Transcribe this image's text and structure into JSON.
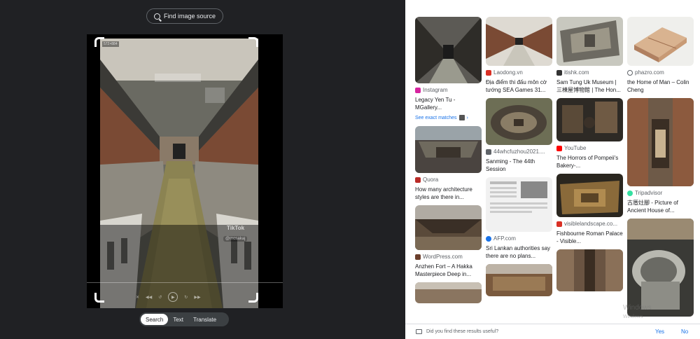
{
  "left": {
    "find_source_label": "Find image source",
    "size_badge": "572×884",
    "watermark_brand": "TikTok",
    "watermark_user": "@mosakaj",
    "modes": [
      "Search",
      "Text",
      "Translate"
    ],
    "active_mode": "Search"
  },
  "results": {
    "col1": [
      {
        "source": "Instagram",
        "title": "Legacy Yen Tu - MGallery...",
        "exact_matches": "See exact matches",
        "icon_color": "#d6249f"
      },
      {
        "source": "Quora",
        "title": "How many architecture styles are there in...",
        "icon_color": "#b92b27"
      },
      {
        "source": "WordPress.com",
        "title": "Anzhen Fort – A Hakka Masterpiece Deep in...",
        "icon_color": "#6b3f2c"
      }
    ],
    "col2": [
      {
        "source": "Laodong.vn",
        "title": "Địa điểm thi đấu môn cờ tướng SEA Games 31...",
        "icon_color": "#d93025"
      },
      {
        "source": "44whcfuzhou2021....",
        "title": "Sanming - The 44th Session",
        "icon_color": "#5f6368"
      },
      {
        "source": "AFP.com",
        "title": "Sri Lankan authorities say there are no plans...",
        "icon_color": "#1a73e8"
      }
    ],
    "col3": [
      {
        "source": "itishk.com",
        "title": "Sam Tung Uk Museum | 三棟屋博物館 | The Hon...",
        "icon_color": "#333333"
      },
      {
        "source": "YouTube",
        "title": "The Horrors of Pompeii's Bakery-...",
        "icon_color": "#ff0000"
      },
      {
        "source": "visiblelandscape.co...",
        "title": "Fishbourne Roman Palace - Visible...",
        "icon_color": "#d93025"
      }
    ],
    "col4": [
      {
        "source": "phazro.com",
        "title": "the Home of Man – Colin Cheng",
        "icon_color": "#5f6368"
      },
      {
        "source": "Tripadvisor",
        "title": "古厝灶腳 - Picture of Ancient House of...",
        "icon_color": "#34e0a1"
      }
    ]
  },
  "feedback": {
    "question": "Did you find these results useful?",
    "yes": "Yes",
    "no": "No"
  },
  "os_watermark": {
    "line1": "Windows",
    "line2": "Windows"
  }
}
